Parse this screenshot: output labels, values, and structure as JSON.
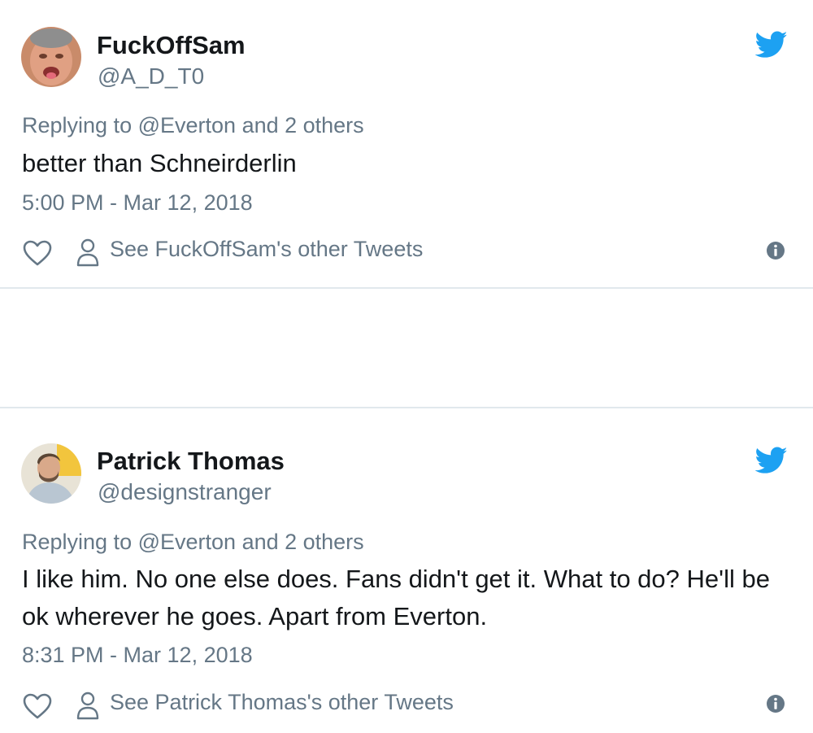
{
  "tweets": [
    {
      "display_name": "FuckOffSam",
      "handle": "@A_D_T0",
      "reply_prefix": "Replying to ",
      "reply_mention": "@Everton",
      "reply_suffix": " and 2 others",
      "text": "better than Schneirderlin",
      "timestamp": "5:00 PM - Mar 12, 2018",
      "other_tweets_label": "See FuckOffSam's other Tweets",
      "avatar_icon": "avatar-photo",
      "brand_icon": "twitter-bird-icon"
    },
    {
      "display_name": "Patrick Thomas",
      "handle": "@designstranger",
      "reply_prefix": "Replying to ",
      "reply_mention": "@Everton",
      "reply_suffix": " and 2 others",
      "text": "I like him. No one else does. Fans didn't get it. What to do? He'll be ok wherever he goes. Apart from Everton.",
      "timestamp": "8:31 PM - Mar 12, 2018",
      "other_tweets_label": "See Patrick Thomas's other Tweets",
      "avatar_icon": "avatar-photo",
      "brand_icon": "twitter-bird-icon"
    }
  ],
  "colors": {
    "twitter_blue": "#1da1f2",
    "text_primary": "#14171a",
    "text_secondary": "#657786",
    "divider": "#e1e8ed"
  }
}
